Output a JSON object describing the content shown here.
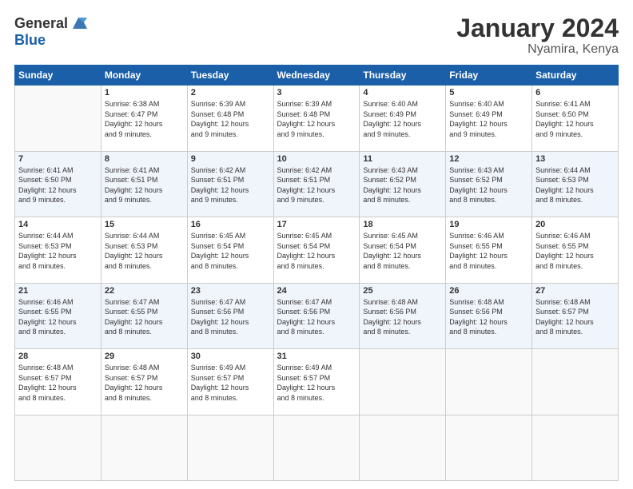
{
  "logo": {
    "general": "General",
    "blue": "Blue"
  },
  "title": "January 2024",
  "location": "Nyamira, Kenya",
  "weekdays": [
    "Sunday",
    "Monday",
    "Tuesday",
    "Wednesday",
    "Thursday",
    "Friday",
    "Saturday"
  ],
  "days": [
    {
      "date": null,
      "number": "",
      "sunrise": "",
      "sunset": "",
      "daylight": ""
    },
    {
      "date": "1",
      "number": "1",
      "sunrise": "6:38 AM",
      "sunset": "6:47 PM",
      "daylight": "12 hours and 9 minutes."
    },
    {
      "date": "2",
      "number": "2",
      "sunrise": "6:39 AM",
      "sunset": "6:48 PM",
      "daylight": "12 hours and 9 minutes."
    },
    {
      "date": "3",
      "number": "3",
      "sunrise": "6:39 AM",
      "sunset": "6:48 PM",
      "daylight": "12 hours and 9 minutes."
    },
    {
      "date": "4",
      "number": "4",
      "sunrise": "6:40 AM",
      "sunset": "6:49 PM",
      "daylight": "12 hours and 9 minutes."
    },
    {
      "date": "5",
      "number": "5",
      "sunrise": "6:40 AM",
      "sunset": "6:49 PM",
      "daylight": "12 hours and 9 minutes."
    },
    {
      "date": "6",
      "number": "6",
      "sunrise": "6:41 AM",
      "sunset": "6:50 PM",
      "daylight": "12 hours and 9 minutes."
    },
    {
      "date": "7",
      "number": "7",
      "sunrise": "6:41 AM",
      "sunset": "6:50 PM",
      "daylight": "12 hours and 9 minutes."
    },
    {
      "date": "8",
      "number": "8",
      "sunrise": "6:41 AM",
      "sunset": "6:51 PM",
      "daylight": "12 hours and 9 minutes."
    },
    {
      "date": "9",
      "number": "9",
      "sunrise": "6:42 AM",
      "sunset": "6:51 PM",
      "daylight": "12 hours and 9 minutes."
    },
    {
      "date": "10",
      "number": "10",
      "sunrise": "6:42 AM",
      "sunset": "6:51 PM",
      "daylight": "12 hours and 9 minutes."
    },
    {
      "date": "11",
      "number": "11",
      "sunrise": "6:43 AM",
      "sunset": "6:52 PM",
      "daylight": "12 hours and 8 minutes."
    },
    {
      "date": "12",
      "number": "12",
      "sunrise": "6:43 AM",
      "sunset": "6:52 PM",
      "daylight": "12 hours and 8 minutes."
    },
    {
      "date": "13",
      "number": "13",
      "sunrise": "6:44 AM",
      "sunset": "6:53 PM",
      "daylight": "12 hours and 8 minutes."
    },
    {
      "date": "14",
      "number": "14",
      "sunrise": "6:44 AM",
      "sunset": "6:53 PM",
      "daylight": "12 hours and 8 minutes."
    },
    {
      "date": "15",
      "number": "15",
      "sunrise": "6:44 AM",
      "sunset": "6:53 PM",
      "daylight": "12 hours and 8 minutes."
    },
    {
      "date": "16",
      "number": "16",
      "sunrise": "6:45 AM",
      "sunset": "6:54 PM",
      "daylight": "12 hours and 8 minutes."
    },
    {
      "date": "17",
      "number": "17",
      "sunrise": "6:45 AM",
      "sunset": "6:54 PM",
      "daylight": "12 hours and 8 minutes."
    },
    {
      "date": "18",
      "number": "18",
      "sunrise": "6:45 AM",
      "sunset": "6:54 PM",
      "daylight": "12 hours and 8 minutes."
    },
    {
      "date": "19",
      "number": "19",
      "sunrise": "6:46 AM",
      "sunset": "6:55 PM",
      "daylight": "12 hours and 8 minutes."
    },
    {
      "date": "20",
      "number": "20",
      "sunrise": "6:46 AM",
      "sunset": "6:55 PM",
      "daylight": "12 hours and 8 minutes."
    },
    {
      "date": "21",
      "number": "21",
      "sunrise": "6:46 AM",
      "sunset": "6:55 PM",
      "daylight": "12 hours and 8 minutes."
    },
    {
      "date": "22",
      "number": "22",
      "sunrise": "6:47 AM",
      "sunset": "6:55 PM",
      "daylight": "12 hours and 8 minutes."
    },
    {
      "date": "23",
      "number": "23",
      "sunrise": "6:47 AM",
      "sunset": "6:56 PM",
      "daylight": "12 hours and 8 minutes."
    },
    {
      "date": "24",
      "number": "24",
      "sunrise": "6:47 AM",
      "sunset": "6:56 PM",
      "daylight": "12 hours and 8 minutes."
    },
    {
      "date": "25",
      "number": "25",
      "sunrise": "6:48 AM",
      "sunset": "6:56 PM",
      "daylight": "12 hours and 8 minutes."
    },
    {
      "date": "26",
      "number": "26",
      "sunrise": "6:48 AM",
      "sunset": "6:56 PM",
      "daylight": "12 hours and 8 minutes."
    },
    {
      "date": "27",
      "number": "27",
      "sunrise": "6:48 AM",
      "sunset": "6:57 PM",
      "daylight": "12 hours and 8 minutes."
    },
    {
      "date": "28",
      "number": "28",
      "sunrise": "6:48 AM",
      "sunset": "6:57 PM",
      "daylight": "12 hours and 8 minutes."
    },
    {
      "date": "29",
      "number": "29",
      "sunrise": "6:48 AM",
      "sunset": "6:57 PM",
      "daylight": "12 hours and 8 minutes."
    },
    {
      "date": "30",
      "number": "30",
      "sunrise": "6:49 AM",
      "sunset": "6:57 PM",
      "daylight": "12 hours and 8 minutes."
    },
    {
      "date": "31",
      "number": "31",
      "sunrise": "6:49 AM",
      "sunset": "6:57 PM",
      "daylight": "12 hours and 8 minutes."
    },
    {
      "date": null,
      "number": "",
      "sunrise": "",
      "sunset": "",
      "daylight": ""
    },
    {
      "date": null,
      "number": "",
      "sunrise": "",
      "sunset": "",
      "daylight": ""
    },
    {
      "date": null,
      "number": "",
      "sunrise": "",
      "sunset": "",
      "daylight": ""
    },
    {
      "date": null,
      "number": "",
      "sunrise": "",
      "sunset": "",
      "daylight": ""
    }
  ]
}
